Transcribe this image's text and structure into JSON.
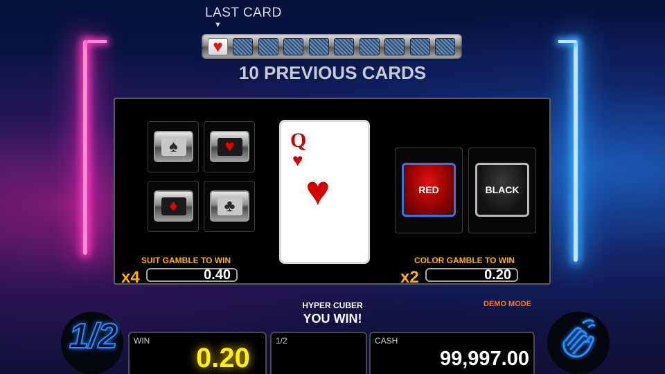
{
  "history": {
    "last_card_label": "LAST CARD",
    "arrow": "▼",
    "previous_cards_title": "10 PREVIOUS CARDS",
    "slots": [
      {
        "state": "face-up",
        "suit": "♥"
      },
      {
        "state": "card-back"
      },
      {
        "state": "card-back"
      },
      {
        "state": "card-back"
      },
      {
        "state": "card-back"
      },
      {
        "state": "card-back"
      },
      {
        "state": "card-back"
      },
      {
        "state": "card-back"
      },
      {
        "state": "card-back"
      },
      {
        "state": "card-back"
      }
    ]
  },
  "suit_gamble": {
    "suits": {
      "spade": "♠",
      "heart": "♥",
      "diamond": "♦",
      "club": "♣"
    },
    "label": "SUIT GAMBLE TO WIN",
    "multiplier": "x4",
    "value": "0.40"
  },
  "current_card": {
    "rank": "Q",
    "suit": "♥"
  },
  "color_gamble": {
    "red_label": "RED",
    "black_label": "BLACK",
    "label": "COLOR GAMBLE TO WIN",
    "multiplier": "x2",
    "value": "0.20"
  },
  "status": {
    "game_name": "HYPER CUBER",
    "message": "YOU WIN!",
    "mode": "DEMO MODE"
  },
  "bottom": {
    "half_button": "1/2",
    "win_label": "WIN",
    "win_value": "0.20",
    "half_label": "1/2",
    "cash_label": "CASH",
    "cash_value": "99,997.00"
  },
  "colors": {
    "accent_gold": "#ffb000",
    "win_yellow": "#fff200",
    "red_select": "#2a78e0",
    "suit_red": "#c80000"
  },
  "icons": [
    "spade-icon",
    "heart-icon",
    "diamond-icon",
    "club-icon",
    "half-gamble-icon",
    "hand-collect-icon"
  ]
}
